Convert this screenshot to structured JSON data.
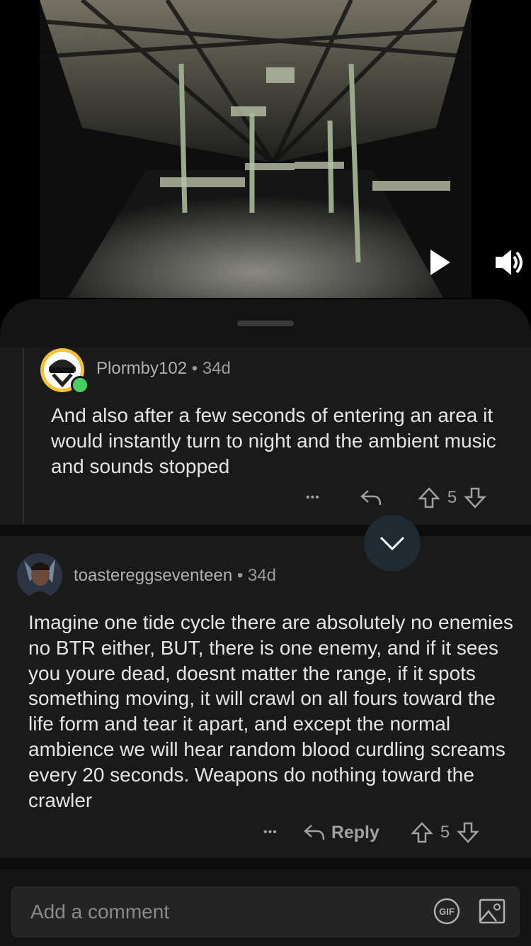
{
  "video": {
    "play_icon": "play-icon",
    "volume_icon": "volume-icon"
  },
  "comments": [
    {
      "username": "Plormby102",
      "separator": "•",
      "age": "34d",
      "body": "And also after a few seconds of entering an area it would instantly turn to night and the ambient music and sounds stopped",
      "more_label": "•••",
      "score": "5"
    },
    {
      "username": "toastereggseventeen",
      "separator": "•",
      "age": "34d",
      "body": "Imagine one tide cycle there are absolutely no enemies no BTR either, BUT, there is one enemy, and if it sees you youre dead, doesnt matter the range, if it spots something moving, it will crawl on all fours toward the life form and tear it apart, and except the normal ambience we will hear random blood curdling screams every 20 seconds. Weapons do nothing toward the crawler",
      "more_label": "•••",
      "reply_label": "Reply",
      "score": "5"
    }
  ],
  "composer": {
    "placeholder": "Add a comment",
    "gif_label": "GIF"
  },
  "colors": {
    "online": "#46d160",
    "sheet_bg": "#141414",
    "comment_bg": "#1a1a1b"
  }
}
